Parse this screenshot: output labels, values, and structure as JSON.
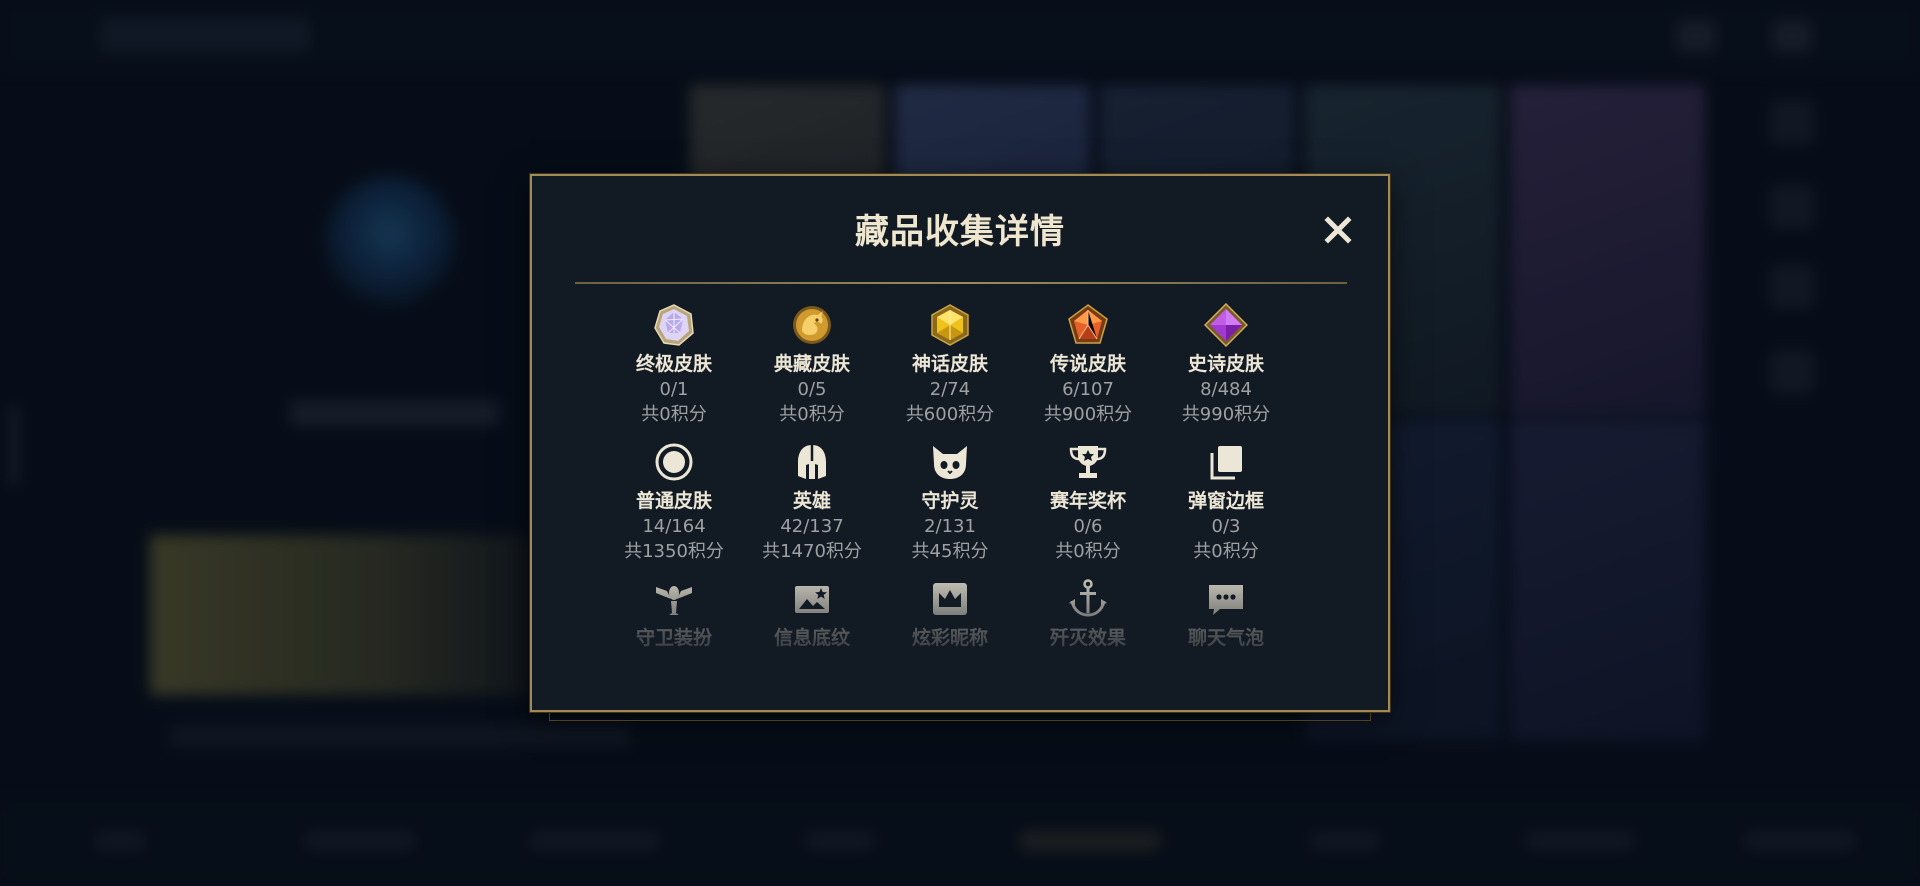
{
  "modal": {
    "title": "藏品收集详情",
    "close_icon": "close-icon",
    "border_color": "#a38a55",
    "background": "#121a24"
  },
  "collections": [
    {
      "label": "终极皮肤",
      "count": "0/1",
      "points": "共0积分",
      "icon": "ultimate-skin-gem-icon"
    },
    {
      "label": "典藏皮肤",
      "count": "0/5",
      "points": "共0积分",
      "icon": "prestige-skin-dragon-icon"
    },
    {
      "label": "神话皮肤",
      "count": "2/74",
      "points": "共600积分",
      "icon": "mythic-skin-gem-icon"
    },
    {
      "label": "传说皮肤",
      "count": "6/107",
      "points": "共900积分",
      "icon": "legendary-skin-gem-icon"
    },
    {
      "label": "史诗皮肤",
      "count": "8/484",
      "points": "共990积分",
      "icon": "epic-skin-gem-icon"
    },
    {
      "label": "普通皮肤",
      "count": "14/164",
      "points": "共1350积分",
      "icon": "common-skin-circle-icon"
    },
    {
      "label": "英雄",
      "count": "42/137",
      "points": "共1470积分",
      "icon": "champion-helmet-icon"
    },
    {
      "label": "守护灵",
      "count": "2/131",
      "points": "共45积分",
      "icon": "guardian-cat-icon"
    },
    {
      "label": "赛年奖杯",
      "count": "0/6",
      "points": "共0积分",
      "icon": "season-trophy-icon"
    },
    {
      "label": "弹窗边框",
      "count": "0/3",
      "points": "共0积分",
      "icon": "frame-stack-icon"
    },
    {
      "label": "守卫装扮",
      "icon": "ward-skin-icon"
    },
    {
      "label": "信息底纹",
      "icon": "banner-image-icon"
    },
    {
      "label": "炫彩昵称",
      "icon": "crown-nameplate-icon"
    },
    {
      "label": "歼灭效果",
      "icon": "anchor-finisher-icon"
    },
    {
      "label": "聊天气泡",
      "icon": "chat-bubble-icon"
    }
  ],
  "colors": {
    "gold": "#c9aa71",
    "mythic": "#e2b422",
    "legendary": "#e2602a",
    "epic": "#a83ad8",
    "ultimate": "#c8b8f0"
  }
}
